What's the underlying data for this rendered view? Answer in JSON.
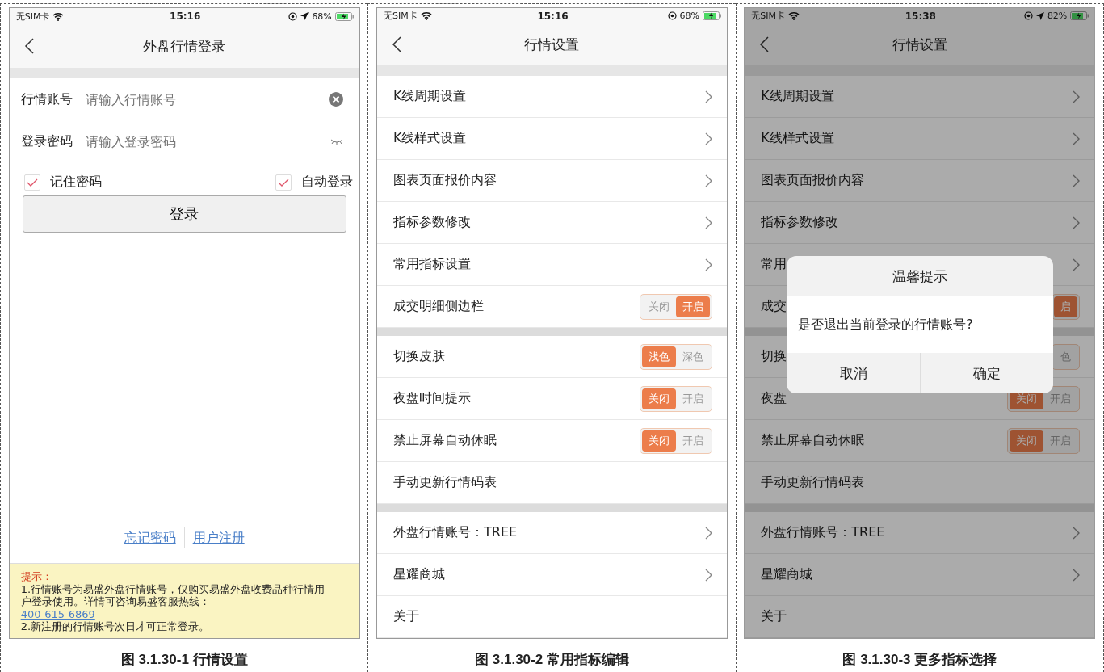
{
  "figures": [
    {
      "caption": "图 3.1.30-1 行情设置",
      "screen": {
        "kind": "login",
        "status_bar": {
          "carrier": "无SIM卡",
          "time": "15:16",
          "location": true,
          "battery": "68%"
        },
        "title": "外盘行情登录",
        "fields": [
          {
            "label": "行情账号",
            "placeholder": "请输入行情账号",
            "kind": "clear"
          },
          {
            "label": "登录密码",
            "placeholder": "请输入登录密码",
            "kind": "eye"
          }
        ],
        "checks": [
          {
            "label": "记住密码",
            "checked": true
          },
          {
            "label": "自动登录",
            "checked": true
          }
        ],
        "button": "登录",
        "links": [
          "忘记密码",
          "用户注册"
        ],
        "hint": {
          "title": "提示：",
          "text": "1.行情账号为易盛外盘行情账号，仅购买易盛外盘收费品种行情用户登录使用。详情可咨询易盛客服热线：",
          "phone": "400-615-6869",
          "note": "2.新注册的行情账号次日才可正常登录。"
        }
      }
    },
    {
      "caption": "图 3.1.30-2 常用指标编辑",
      "screen": {
        "kind": "settings",
        "status_bar": {
          "carrier": "无SIM卡",
          "time": "15:16",
          "location": false,
          "battery": "68%"
        },
        "title": "行情设置",
        "sections": [
          [
            {
              "label": "K线周期设置",
              "kind": "link"
            },
            {
              "label": "K线样式设置",
              "kind": "link"
            },
            {
              "label": "图表页面报价内容",
              "kind": "link"
            },
            {
              "label": "指标参数修改",
              "kind": "link"
            },
            {
              "label": "常用指标设置",
              "kind": "link"
            },
            {
              "label": "成交明细侧边栏",
              "kind": "toggle",
              "options": [
                {
                  "label": "关闭",
                  "selected": false
                },
                {
                  "label": "开启",
                  "selected": true
                }
              ]
            }
          ],
          [
            {
              "label": "切换皮肤",
              "kind": "toggle",
              "options": [
                {
                  "label": "浅色",
                  "selected": true
                },
                {
                  "label": "深色",
                  "selected": false
                }
              ]
            },
            {
              "label": "夜盘时间提示",
              "kind": "toggle",
              "options": [
                {
                  "label": "关闭",
                  "selected": true
                },
                {
                  "label": "开启",
                  "selected": false
                }
              ]
            },
            {
              "label": "禁止屏幕自动休眠",
              "kind": "toggle",
              "options": [
                {
                  "label": "关闭",
                  "selected": true
                },
                {
                  "label": "开启",
                  "selected": false
                }
              ]
            },
            {
              "label": "手动更新行情码表",
              "kind": "plain"
            }
          ],
          [
            {
              "label": "外盘行情账号：TREE",
              "kind": "link"
            },
            {
              "label": "星耀商城",
              "kind": "link"
            },
            {
              "label": "关于",
              "kind": "plain"
            }
          ]
        ]
      }
    },
    {
      "caption": "图 3.1.30-3 更多指标选择",
      "screen": {
        "kind": "settings",
        "status_bar": {
          "carrier": "无SIM卡",
          "time": "15:38",
          "location": true,
          "battery": "82%"
        },
        "title": "行情设置",
        "sections": [
          [
            {
              "label": "K线周期设置",
              "kind": "link"
            },
            {
              "label": "K线样式设置",
              "kind": "link"
            },
            {
              "label": "图表页面报价内容",
              "kind": "link"
            },
            {
              "label": "指标参数修改",
              "kind": "link"
            },
            {
              "label": "常用",
              "kind": "link"
            },
            {
              "label": "成交",
              "kind": "toggle",
              "options": [
                {
                  "label": "启",
                  "selected": true
                }
              ]
            }
          ],
          [
            {
              "label": "切换",
              "kind": "toggle",
              "options": [
                {
                  "label": "色",
                  "selected": false
                }
              ]
            },
            {
              "label": "夜盘",
              "kind": "toggle",
              "options": [
                {
                  "label": "关闭",
                  "selected": true
                },
                {
                  "label": "开启",
                  "selected": false
                }
              ]
            },
            {
              "label": "禁止屏幕自动休眠",
              "kind": "toggle",
              "options": [
                {
                  "label": "关闭",
                  "selected": true
                },
                {
                  "label": "开启",
                  "selected": false
                }
              ]
            },
            {
              "label": "手动更新行情码表",
              "kind": "plain"
            }
          ],
          [
            {
              "label": "外盘行情账号：TREE",
              "kind": "link"
            },
            {
              "label": "星耀商城",
              "kind": "link"
            },
            {
              "label": "关于",
              "kind": "plain"
            }
          ]
        ],
        "dialog": {
          "title": "温馨提示",
          "message": "是否退出当前登录的行情账号?",
          "buttons": [
            "取消",
            "确定"
          ]
        }
      }
    }
  ]
}
